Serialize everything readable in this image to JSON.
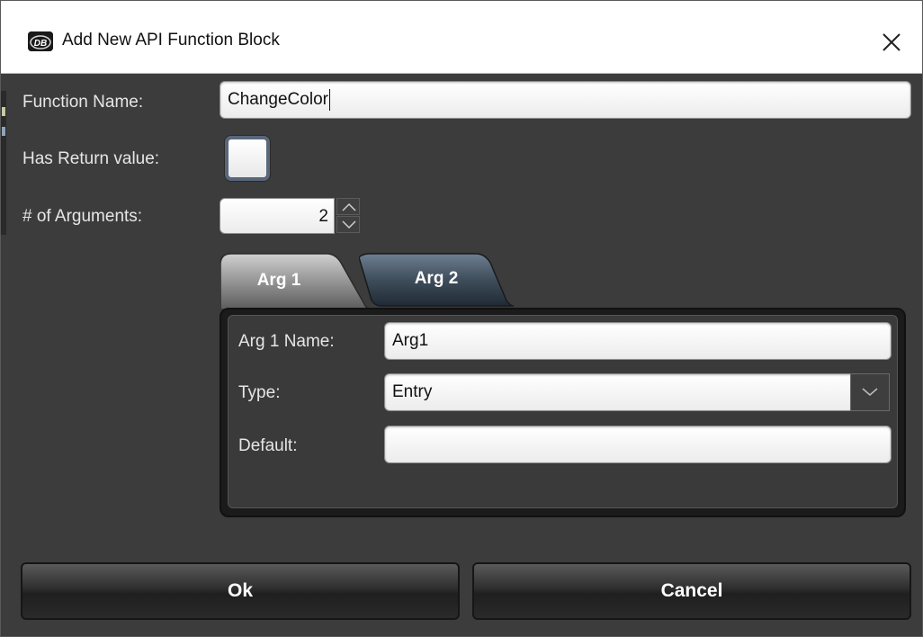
{
  "window": {
    "title": "Add New API Function Block",
    "app_icon_text": "DB"
  },
  "form": {
    "function_name_label": "Function Name:",
    "function_name_value": "ChangeColor",
    "has_return_label": "Has Return value:",
    "has_return_checked": false,
    "arg_count_label": "# of Arguments:",
    "arg_count_value": "2"
  },
  "tabs": [
    {
      "label": "Arg 1",
      "active": true
    },
    {
      "label": "Arg 2",
      "active": false
    }
  ],
  "arg_panel": {
    "name_label": "Arg 1 Name:",
    "name_value": "Arg1",
    "type_label": "Type:",
    "type_value": "Entry",
    "default_label": "Default:",
    "default_value": ""
  },
  "buttons": {
    "ok": "Ok",
    "cancel": "Cancel"
  }
}
